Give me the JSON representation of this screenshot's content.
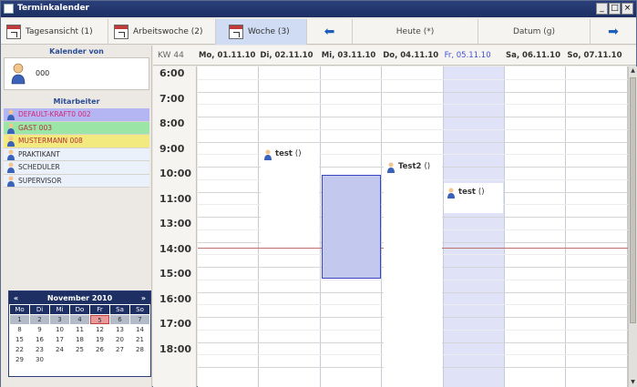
{
  "window": {
    "title": "Terminkalender",
    "minimize": "_",
    "maximize": "□",
    "close": "×"
  },
  "toolbar": {
    "day_view": "Tagesansicht (1)",
    "work_week": "Arbeitswoche (2)",
    "week": "Woche (3)",
    "today": "Heute (*)",
    "date": "Datum (g)"
  },
  "sidebar": {
    "calendar_of_label": "Kalender von",
    "owner_name": "000",
    "staff_label": "Mitarbeiter",
    "staff": [
      {
        "name": "DEFAULT-KRAFT0 002",
        "bg": "#b3b6f2",
        "color": "#d8257a"
      },
      {
        "name": "GAST 003",
        "bg": "#9be6a6",
        "color": "#b33434"
      },
      {
        "name": "MUSTERMANN 008",
        "bg": "#f2ea7e",
        "color": "#b33434"
      },
      {
        "name": "PRAKTIKANT",
        "bg": "#eaf1fb",
        "color": "#333333"
      },
      {
        "name": "SCHEDULER",
        "bg": "#eaf1fb",
        "color": "#333333"
      },
      {
        "name": "SUPERVISOR",
        "bg": "#eaf1fb",
        "color": "#333333"
      }
    ]
  },
  "mini_calendar": {
    "prev": "«",
    "month": "November 2010",
    "next": "»",
    "dow": [
      "Mo",
      "Di",
      "Mi",
      "Do",
      "Fr",
      "Sa",
      "So"
    ],
    "weeks": [
      [
        "1",
        "2",
        "3",
        "4",
        "5",
        "6",
        "7"
      ],
      [
        "8",
        "9",
        "10",
        "11",
        "12",
        "13",
        "14"
      ],
      [
        "15",
        "16",
        "17",
        "18",
        "19",
        "20",
        "21"
      ],
      [
        "22",
        "23",
        "24",
        "25",
        "26",
        "27",
        "28"
      ],
      [
        "29",
        "30",
        "",
        "",
        "",
        "",
        ""
      ]
    ],
    "selected_day": "5"
  },
  "calendar": {
    "kw": "KW 44",
    "days": [
      "Mo, 01.11.10",
      "Di, 02.11.10",
      "Mi, 03.11.10",
      "Do, 04.11.10",
      "Fr, 05.11.10",
      "Sa, 06.11.10",
      "So, 07.11.10"
    ],
    "today_index": 4,
    "hours": [
      "6:00",
      "7:00",
      "8:00",
      "9:00",
      "10:00",
      "11:00",
      "13:00",
      "14:00",
      "15:00",
      "16:00",
      "17:00",
      "18:00"
    ],
    "events": [
      {
        "title": "test",
        "suffix": "()"
      },
      {
        "title": "Test2",
        "suffix": "()"
      },
      {
        "title": "test",
        "suffix": "()"
      }
    ]
  },
  "colors": {
    "accent": "#1d2f63",
    "today_column": "#e0e3f7",
    "selection": "#c3c8ee",
    "now_line": "#c07070"
  }
}
